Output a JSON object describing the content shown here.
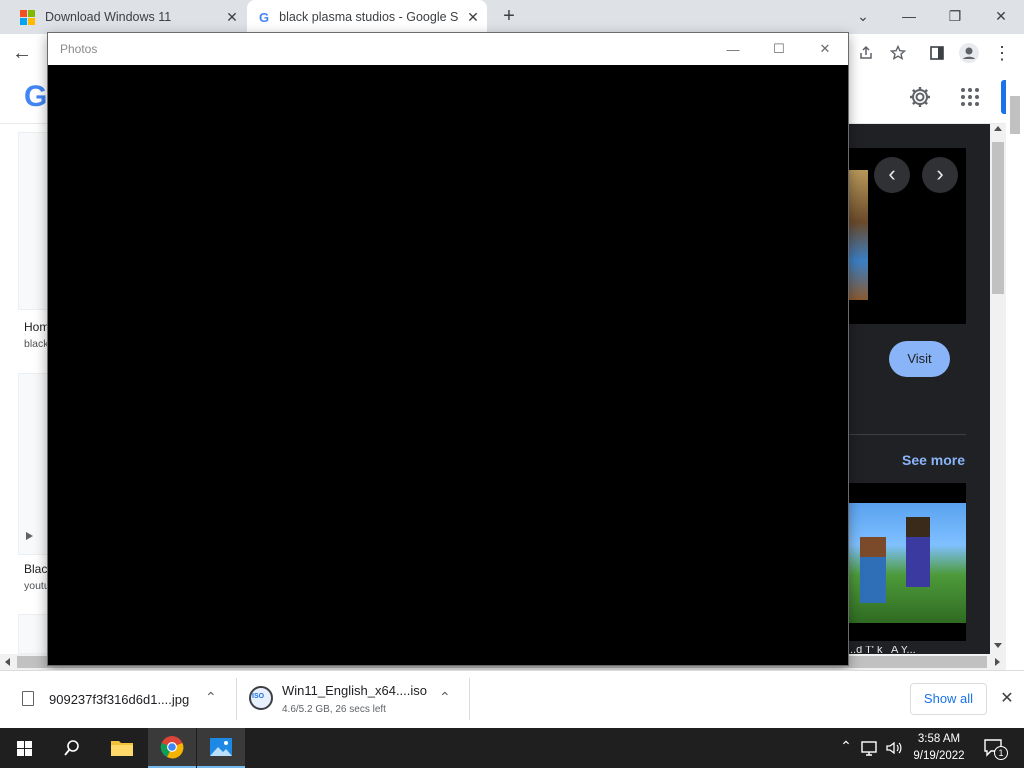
{
  "browser": {
    "tabs": [
      {
        "title": "Download Windows 11"
      },
      {
        "title": "black plasma studios - Google Se"
      }
    ],
    "new_tab_glyph": "+",
    "tab_close_glyph": "✕",
    "controls": {
      "chevron": "⌄",
      "minimize": "—",
      "restore": "❐",
      "close": "✕"
    },
    "nav": {
      "back": "←"
    },
    "toolbar_icons": [
      "share-icon",
      "star-icon",
      "side-panel-icon",
      "profile-icon",
      "menu-icon"
    ],
    "menu_glyph": "⋮"
  },
  "google_page": {
    "logo_letter": "G",
    "left_results": [
      {
        "title_stub": "Hom",
        "source_stub": "black"
      },
      {
        "title_stub": "Blac",
        "source_stub": "youtu"
      }
    ],
    "carousel": {
      "prev": "‹",
      "next": "›"
    },
    "visit_label": "Visit",
    "see_more_label": "See more",
    "truncated_caption": "..d T' k_ A  Y..."
  },
  "photos_window": {
    "title": "Photos",
    "controls": {
      "minimize": "—",
      "maximize": "☐",
      "close": "✕"
    }
  },
  "downloads": {
    "items": [
      {
        "filename": "909237f3f316d6d1....jpg",
        "status": ""
      },
      {
        "filename": "Win11_English_x64....iso",
        "status": "4.6/5.2 GB, 26 secs left",
        "badge": "ISO"
      }
    ],
    "show_all_label": "Show all",
    "close_glyph": "✕",
    "chevron": "⌃"
  },
  "taskbar": {
    "time": "3:58 AM",
    "date": "9/19/2022",
    "notification_count": "1"
  },
  "colors": {
    "accent_blue": "#1a73e8",
    "visit_button": "#8ab4f8",
    "see_more": "#8ab4f8",
    "taskbar": "#1f1f1f"
  }
}
